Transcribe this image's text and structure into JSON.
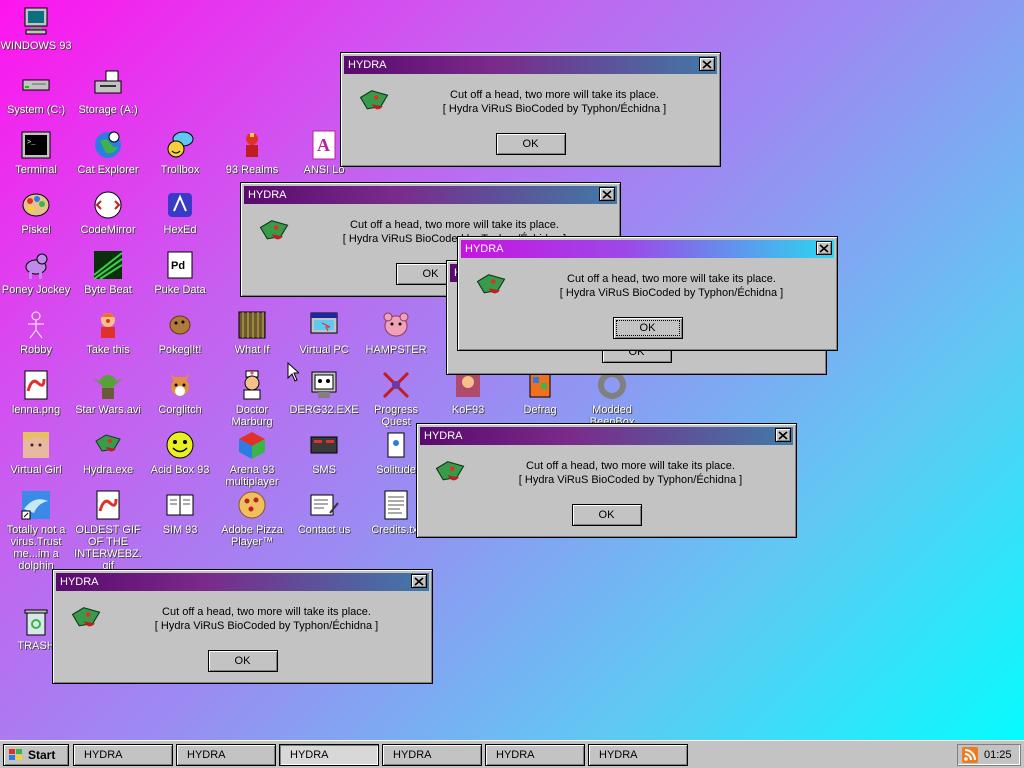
{
  "desktop_icons": [
    {
      "label": "WINDOWS 93",
      "icon": "computer-icon"
    },
    {
      "label": "System (C:)",
      "icon": "drive-icon"
    },
    {
      "label": "Storage (A:)",
      "icon": "floppy-drive-icon"
    },
    {
      "label": "Terminal",
      "icon": "terminal-icon"
    },
    {
      "label": "Cat Explorer",
      "icon": "globe-cat-icon"
    },
    {
      "label": "Trollbox",
      "icon": "chat-icon"
    },
    {
      "label": "93 Realms",
      "icon": "knight-icon"
    },
    {
      "label": "ANSI Lo",
      "icon": "ansi-icon"
    },
    {
      "label": "Piskel",
      "icon": "palette-icon"
    },
    {
      "label": "CodeMirror",
      "icon": "codemirror-icon"
    },
    {
      "label": "HexEd",
      "icon": "hexed-icon"
    },
    {
      "label": "Poney Jockey",
      "icon": "pony-icon"
    },
    {
      "label": "Byte Beat",
      "icon": "bytebeat-icon"
    },
    {
      "label": "Puke Data",
      "icon": "pdf-icon"
    },
    {
      "label": "Robby",
      "icon": "stickman-icon"
    },
    {
      "label": "Take this",
      "icon": "clown-icon"
    },
    {
      "label": "Pokegl!t!",
      "icon": "potato-icon"
    },
    {
      "label": "What If",
      "icon": "whatif-icon"
    },
    {
      "label": "Virtual PC",
      "icon": "virtualpc-icon"
    },
    {
      "label": "HAMPSTER",
      "icon": "hamster-icon"
    },
    {
      "label": "lenna.png",
      "icon": "image-file-icon"
    },
    {
      "label": "Star Wars.avi",
      "icon": "yoda-icon"
    },
    {
      "label": "Corglitch",
      "icon": "corgi-icon"
    },
    {
      "label": "Doctor Marburg",
      "icon": "doctor-icon"
    },
    {
      "label": "DERG32.EXE",
      "icon": "derg-icon"
    },
    {
      "label": "Progress Quest",
      "icon": "swords-icon"
    },
    {
      "label": "KoF93",
      "icon": "fighter-icon"
    },
    {
      "label": "Defrag",
      "icon": "defrag-icon"
    },
    {
      "label": "Modded BeepBox",
      "icon": "ring-icon"
    },
    {
      "label": "Virtual Girl",
      "icon": "face-icon"
    },
    {
      "label": "Hydra.exe",
      "icon": "hydra-icon"
    },
    {
      "label": "Acid Box 93",
      "icon": "smiley-icon"
    },
    {
      "label": "Arena 93 multiplayer",
      "icon": "cube-icon"
    },
    {
      "label": "SMS",
      "icon": "sms-icon"
    },
    {
      "label": "Solitude",
      "icon": "solitude-icon"
    },
    {
      "label": "Totally not a virus.Trust me...im a dolphin",
      "icon": "dolphin-icon"
    },
    {
      "label": "OLDEST GIF OF THE INTERWEBZ.gif",
      "icon": "gif-file-icon"
    },
    {
      "label": "SIM 93",
      "icon": "book-icon"
    },
    {
      "label": "Adobe Pizza Player™",
      "icon": "pizza-icon"
    },
    {
      "label": "Contact us",
      "icon": "contact-icon"
    },
    {
      "label": "Credits.txt",
      "icon": "text-file-icon"
    },
    {
      "label": "TRASH",
      "icon": "trash-icon"
    }
  ],
  "dialog": {
    "title": "HYDRA",
    "line1": "Cut off a head, two more will take its place.",
    "line2": "[ Hydra ViRuS BioCoded by Typhon/Échidna ]",
    "ok_label": "OK"
  },
  "taskbar": {
    "start_label": "Start",
    "tasks": [
      "HYDRA",
      "HYDRA",
      "HYDRA",
      "HYDRA",
      "HYDRA",
      "HYDRA"
    ],
    "clock": "01:25"
  },
  "colors": {
    "desktop_gradient": [
      "#ff14ee",
      "#00ffff"
    ],
    "title_active": [
      "#c813e0",
      "#2ad8f0"
    ],
    "title_inactive": [
      "#5a0a6e",
      "#407aa8"
    ],
    "window_face": "#c3c3c3"
  }
}
